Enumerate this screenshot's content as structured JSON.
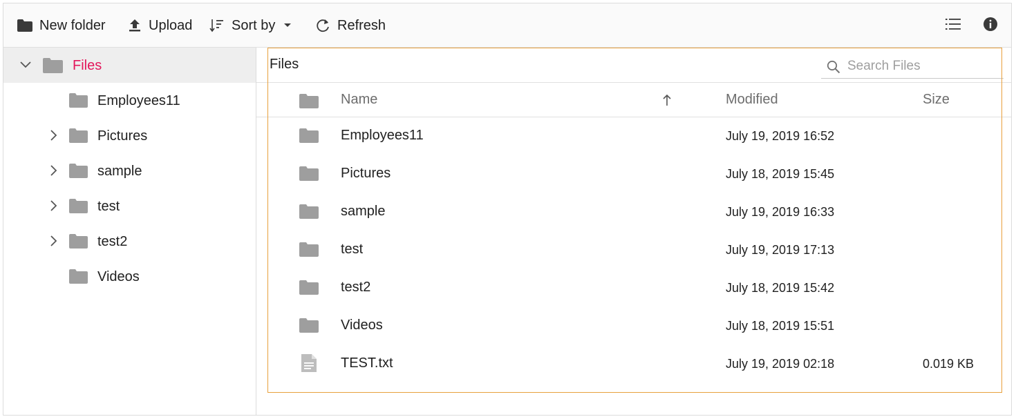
{
  "toolbar": {
    "new_folder": "New folder",
    "upload": "Upload",
    "sort_by": "Sort by",
    "refresh": "Refresh"
  },
  "tree": {
    "root": "Files",
    "items": [
      {
        "label": "Employees11",
        "expandable": false
      },
      {
        "label": "Pictures",
        "expandable": true
      },
      {
        "label": "sample",
        "expandable": true
      },
      {
        "label": "test",
        "expandable": true
      },
      {
        "label": "test2",
        "expandable": true
      },
      {
        "label": "Videos",
        "expandable": false
      }
    ]
  },
  "address": {
    "crumb": "Files",
    "search_placeholder": "Search Files"
  },
  "grid": {
    "headers": {
      "name": "Name",
      "modified": "Modified",
      "size": "Size"
    },
    "sort_direction": "ascending",
    "rows": [
      {
        "name": "Employees11",
        "modified": "July 19, 2019 16:52",
        "size": "",
        "type": "folder"
      },
      {
        "name": "Pictures",
        "modified": "July 18, 2019 15:45",
        "size": "",
        "type": "folder"
      },
      {
        "name": "sample",
        "modified": "July 19, 2019 16:33",
        "size": "",
        "type": "folder"
      },
      {
        "name": "test",
        "modified": "July 19, 2019 17:13",
        "size": "",
        "type": "folder"
      },
      {
        "name": "test2",
        "modified": "July 18, 2019 15:42",
        "size": "",
        "type": "folder"
      },
      {
        "name": "Videos",
        "modified": "July 18, 2019 15:51",
        "size": "",
        "type": "folder"
      },
      {
        "name": "TEST.txt",
        "modified": "July 19, 2019 02:18",
        "size": "0.019 KB",
        "type": "file"
      }
    ]
  },
  "colors": {
    "accent": "#e3165b",
    "icon_gray": "#9e9e9e",
    "focus_border": "#e8a03c"
  },
  "icons": {
    "new_folder": "folder-icon",
    "upload": "upload-icon",
    "sort": "sort-icon",
    "refresh": "refresh-icon",
    "view": "list-view-icon",
    "details": "info-icon",
    "search": "search-icon"
  }
}
